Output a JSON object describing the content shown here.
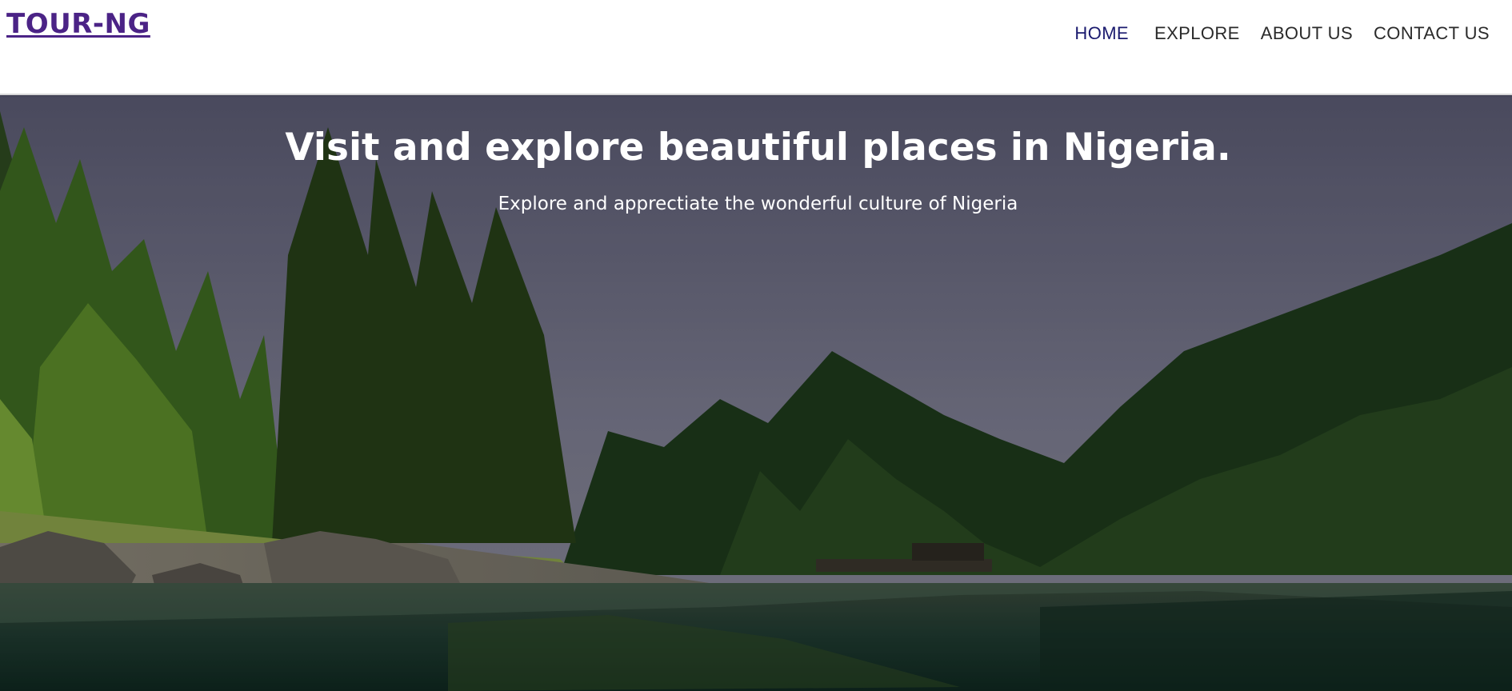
{
  "brand": {
    "logo_text": "TOUR-NG",
    "accent": "#4b2386"
  },
  "nav": {
    "items": [
      {
        "label": "HOME",
        "active": true
      },
      {
        "label": "EXPLORE",
        "active": false
      },
      {
        "label": "ABOUT US",
        "active": false
      },
      {
        "label": "CONTACT US",
        "active": false
      }
    ],
    "active_color": "#1a1a6e"
  },
  "hero": {
    "title": "Visit and explore beautiful places in Nigeria.",
    "subtitle": "Explore and apprectiate the wonderful culture of Nigeria",
    "image": "forest-lake-landscape"
  }
}
